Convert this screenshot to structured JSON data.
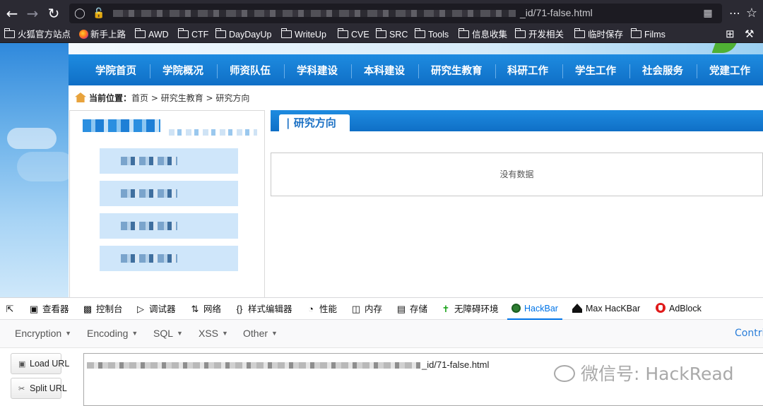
{
  "browser": {
    "url_visible_suffix": "_id/71-false.html",
    "bookmarks": [
      "火狐官方站点",
      "新手上路",
      "AWD",
      "CTF",
      "DayDayUp",
      "WriteUp",
      "CVE",
      "SRC",
      "Tools",
      "信息收集",
      "开发相关",
      "临时保存",
      "Films"
    ]
  },
  "site": {
    "nav": [
      "学院首页",
      "学院概况",
      "师资队伍",
      "学科建设",
      "本科建设",
      "研究生教育",
      "科研工作",
      "学生工作",
      "社会服务",
      "党建工作"
    ],
    "breadcrumb": {
      "label": "当前位置：",
      "path": "首页 > 研究生教育 > 研究方向"
    },
    "section_title": "| 研究方向",
    "empty_message": "没有数据"
  },
  "devtools": {
    "tabs": [
      "查看器",
      "控制台",
      "调试器",
      "网络",
      "样式编辑器",
      "性能",
      "内存",
      "存储",
      "无障碍环境",
      "HackBar",
      "Max HacKBar",
      "AdBlock"
    ],
    "active_tab": "HackBar"
  },
  "hackbar": {
    "menus": [
      "Encryption",
      "Encoding",
      "SQL",
      "XSS",
      "Other"
    ],
    "contribute": "Contri",
    "load_url": "Load URL",
    "split_url": "Split URL",
    "url_visible_suffix": "_id/71-false.html"
  },
  "watermark": "微信号: HackRead"
}
